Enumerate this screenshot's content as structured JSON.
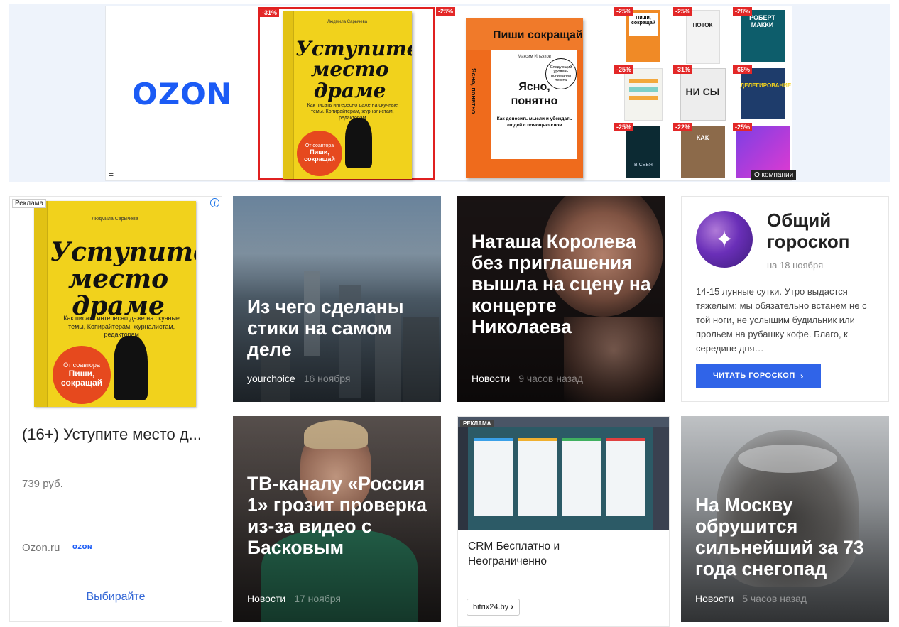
{
  "banner": {
    "logo": "OZON",
    "menu_glyph": "=",
    "about_label": "О компании",
    "main_book": {
      "discount": "-31%",
      "author": "Людмила Сарычева",
      "title_lines": [
        "Уступите",
        "место",
        "драме"
      ],
      "subtitle": "Как писать интересно даже на скучные темы. Копирайтерам, журналистам, редакторам",
      "circle_top": "От соавтора",
      "circle_main": "Пиши, сокращай"
    },
    "second_book": {
      "discount": "-25%",
      "top_text": "Пиши сокращай",
      "author": "Максим Ильяхов",
      "title_lines": [
        "Ясно,",
        "понятно"
      ],
      "subtitle": "Как доносить мысли и убеждать людей с помощью слов",
      "badge": "Следующий уровень понимания текста",
      "spine": "Ясно, понятно"
    },
    "thumbs": [
      {
        "discount": "-25%",
        "text": "Пиши, сокращай"
      },
      {
        "discount": "-25%",
        "text": "ПОТОК"
      },
      {
        "discount": "-28%",
        "text": "РОБЕРТ МАККИ"
      },
      {
        "discount": "-25%",
        "text": ""
      },
      {
        "discount": "-31%",
        "text": "НИ СЫ"
      },
      {
        "discount": "-66%",
        "text": "ДЕЛЕГИРОВАНИЕ"
      },
      {
        "discount": "-25%",
        "text": "В СЕБЯ"
      },
      {
        "discount": "-22%",
        "text": "КАК"
      },
      {
        "discount": "-25%",
        "text": ""
      }
    ],
    "colors": {
      "ozon_blue": "#1b5bf5",
      "discount_red": "#e32727"
    }
  },
  "ad_card": {
    "label": "Реклама",
    "info_icon": "i",
    "book": {
      "author": "Людмила Сарычева",
      "title_lines": [
        "Уступите",
        "место",
        "драме"
      ],
      "subtitle": "Как писать интересно даже на скучные темы, Копирайтерам, журналистам, редакторам",
      "circle_top": "От соавтора",
      "circle_main": "Пиши, сокращай"
    },
    "title": "(16+) Уступите место д...",
    "price": "739 руб.",
    "domain": "Ozon.ru",
    "mini_logo": "OZON",
    "cta": "Выбирайте"
  },
  "news": [
    {
      "title": "Из чего сделаны стики на самом деле",
      "source": "yourchoice",
      "time": "16 ноября"
    },
    {
      "title": "Наташа Королева без приглашения вышла на сцену на концерте Николаева",
      "source": "Новости",
      "time": "9 часов назад"
    },
    {
      "title": "ТВ-каналу «Россия 1» грозит проверка из-за видео с Басковым",
      "source": "Новости",
      "time": "17 ноября"
    },
    {
      "title": "На Москву обрушится сильнейший за 73 года снегопад",
      "source": "Новости",
      "time": "5 часов назад"
    }
  ],
  "horoscope": {
    "title": "Общий гороскоп",
    "date": "на 18 ноября",
    "text": "14-15 лунные сутки. Утро выдастся тяжелым: мы обязательно встанем не с той ноги, не услышим будильник или прольем на рубашку кофе. Благо, к середине дня…",
    "button": "ЧИТАТЬ ГОРОСКОП",
    "button_arrow": "›",
    "icon": "sparkle-icon",
    "button_color": "#3064e8"
  },
  "crm_ad": {
    "label": "РЕКЛАМА",
    "title": "CRM Бесплатно и Неограниченно",
    "domain": "bitrix24.by",
    "domain_arrow": "›"
  }
}
